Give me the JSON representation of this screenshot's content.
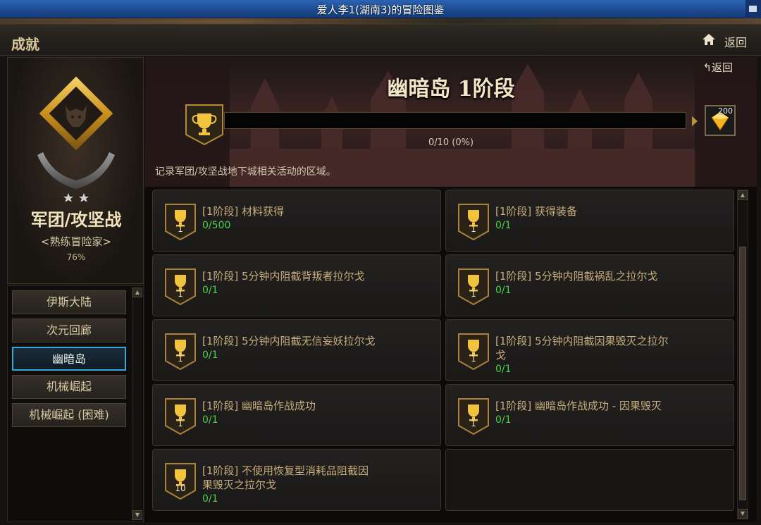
{
  "window": {
    "title": "爱人李1(湖南3)的冒险图鉴"
  },
  "header": {
    "label": "成就",
    "back_label": "返回"
  },
  "category": {
    "name": "军团/攻坚战",
    "rank": "<熟练冒险家>",
    "percent": "76%"
  },
  "nav": {
    "items": [
      {
        "label": "伊斯大陆",
        "active": false
      },
      {
        "label": "次元回廊",
        "active": false
      },
      {
        "label": "幽暗岛",
        "active": true
      },
      {
        "label": "机械崛起",
        "active": false
      },
      {
        "label": "机械崛起 (困难)",
        "active": false
      }
    ]
  },
  "stage": {
    "title": "幽暗岛 1阶段",
    "back_label": "返回",
    "progress_text": "0/10 (0%)",
    "progress_fraction": 0,
    "reward_count": "200",
    "description": "记录军团/攻坚战地下城相关活动的区域。"
  },
  "achievements": [
    {
      "name": "[1阶段] 材料获得",
      "progress": "0/500",
      "points": "1"
    },
    {
      "name": "[1阶段] 获得装备",
      "progress": "0/1",
      "points": "1"
    },
    {
      "name": "[1阶段] 5分钟内阻截背叛者拉尔戈",
      "progress": "0/1",
      "points": "1"
    },
    {
      "name": "[1阶段] 5分钟内阻截祸乱之拉尔戈",
      "progress": "0/1",
      "points": "1"
    },
    {
      "name": "[1阶段] 5分钟内阻截无信妄妖拉尔戈",
      "progress": "0/1",
      "points": "1"
    },
    {
      "name": "[1阶段] 5分钟内阻截因果毁灭之拉尔戈",
      "progress": "0/1",
      "points": "1"
    },
    {
      "name": "[1阶段] 幽暗岛作战成功",
      "progress": "0/1",
      "points": "1"
    },
    {
      "name": "[1阶段] 幽暗岛作战成功 - 因果毁灭",
      "progress": "0/1",
      "points": "1"
    },
    {
      "name": "[1阶段] 不使用恢复型消耗品阻截因果毁灭之拉尔戈",
      "progress": "0/1",
      "points": "10"
    }
  ],
  "colors": {
    "accent": "#3aa6d8",
    "gold": "#c99b2c",
    "progress_green": "#4ad14a",
    "text": "#c7ad7c"
  },
  "icons": {
    "home": "home-icon",
    "trophy": "trophy-icon",
    "reward": "gem-box-icon",
    "emblem": "demon-emblem-icon"
  }
}
